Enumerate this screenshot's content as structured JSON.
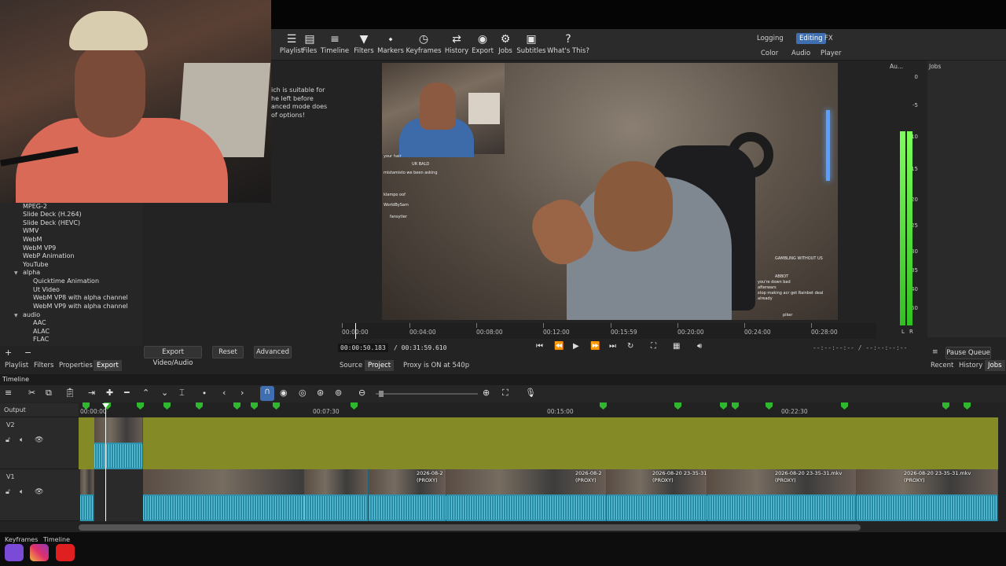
{
  "toolbar": {
    "items": [
      {
        "label": "Playlist",
        "icon": "playlist-icon"
      },
      {
        "label": "Files",
        "icon": "files-icon"
      },
      {
        "label": "Timeline",
        "icon": "timeline-icon"
      },
      {
        "label": "Filters",
        "icon": "filters-icon"
      },
      {
        "label": "Markers",
        "icon": "markers-icon"
      },
      {
        "label": "Keyframes",
        "icon": "keyframes-icon"
      },
      {
        "label": "History",
        "icon": "history-icon"
      },
      {
        "label": "Export",
        "icon": "export-icon"
      },
      {
        "label": "Jobs",
        "icon": "jobs-icon"
      },
      {
        "label": "Subtitles",
        "icon": "subtitles-icon"
      },
      {
        "label": "What's This?",
        "icon": "help-icon"
      }
    ],
    "workspaces_top": [
      "Logging",
      "Editing",
      "FX"
    ],
    "workspaces_bottom": [
      "Color",
      "Audio",
      "Player"
    ],
    "active_workspace": "Editing"
  },
  "export_panel": {
    "description_lines": [
      "ich is suitable for",
      "he left before",
      "anced mode does",
      "of options!"
    ],
    "formats": [
      "MPEG-2",
      "Slide Deck (H.264)",
      "Slide Deck (HEVC)",
      "WMV",
      "WebM",
      "WebM VP9",
      "WebP Animation",
      "YouTube"
    ],
    "alpha_group": "alpha",
    "alpha_items": [
      "Quicktime Animation",
      "Ut Video",
      "WebM VP8 with alpha channel",
      "WebM VP9 with alpha channel"
    ],
    "audio_group": "audio",
    "audio_items": [
      "AAC",
      "ALAC",
      "FLAC"
    ],
    "add_label": "+",
    "remove_label": "−",
    "export_button": "Export Video/Audio",
    "reset_button": "Reset",
    "advanced_button": "Advanced"
  },
  "left_tabs": [
    "Playlist",
    "Filters",
    "Properties",
    "Export"
  ],
  "left_active_tab": "Export",
  "player": {
    "ruler_labels": [
      "00:00:00",
      "00:04:00",
      "00:08:00",
      "00:12:00",
      "00:15:59",
      "00:20:00",
      "00:24:00",
      "00:28:00"
    ],
    "current_time": "00:00:50.183",
    "total_time": "/ 00:31:59.610",
    "in_out": "--:--:--:-- / --:--:--:--",
    "source_tab": "Source",
    "project_tab": "Project",
    "proxy_status": "Proxy is ON at 540p"
  },
  "chat": [
    {
      "user": "your hair",
      "msg": ""
    },
    {
      "user": "",
      "msg": "UR BALD"
    },
    {
      "user": "mistamisto",
      "msg": "we been asking"
    },
    {
      "user": "klampo",
      "msg": "oof"
    },
    {
      "user": "WorldBySam",
      "msg": ""
    },
    {
      "user": "fansytier",
      "msg": ""
    }
  ],
  "chat_right": [
    "GAMBLING WITHOUT US",
    "ABBOT",
    "you're down bad",
    "afterwars",
    "stop making acr get Rainbet deal",
    "already",
    "piker"
  ],
  "audio_meter": {
    "title": "Au...",
    "scale": [
      "0",
      "-5",
      "-10",
      "-15",
      "-20",
      "-25",
      "-30",
      "-35",
      "-40",
      "-45",
      "-50"
    ],
    "left_label": "L",
    "right_label": "R",
    "level_fraction": 0.78
  },
  "jobs_panel": {
    "title": "Jobs",
    "menu_icon": "menu-icon",
    "pause_queue": "Pause Queue",
    "tabs": [
      "Recent",
      "History",
      "Jobs"
    ],
    "active_tab": "Jobs"
  },
  "timeline": {
    "title": "Timeline",
    "output_label": "Output",
    "ruler_labels": [
      "00:00:00",
      "00:07:30",
      "00:15:00",
      "00:22:30"
    ],
    "tracks": [
      {
        "name": "V2"
      },
      {
        "name": "V1"
      }
    ],
    "clip_labels": [
      "2026-08-2",
      "(PROXY)",
      "2026-08-2",
      "(PROXY)",
      "2026-08-20 23-35-31",
      "(PROXY)",
      "2026-08-20 23-35-31.mkv",
      "(PROXY)",
      "2026-08-20 23-35-31.mkv",
      "(PROXY)"
    ]
  },
  "bottom_tabs": [
    "Keyframes",
    "Timeline"
  ],
  "colors": {
    "v2_track": "#838a26",
    "clip": "#2f93ad",
    "marker": "#2fb82f",
    "accent": "#3f6fb0"
  }
}
